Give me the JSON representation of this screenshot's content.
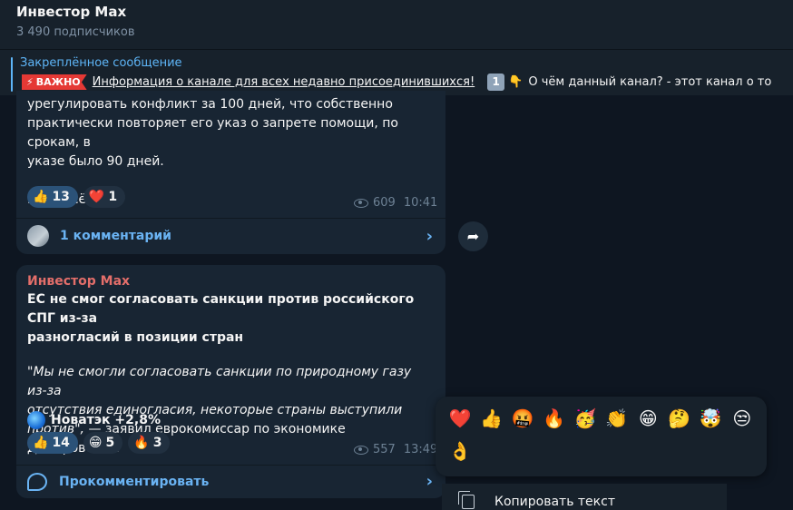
{
  "header": {
    "title": "Инвестор Max",
    "subscribers": "3 490 подписчиков"
  },
  "pinned": {
    "label": "Закреплённое сообщение",
    "badge": "ВАЖНО",
    "link_text": "Информация о канале для всех недавно присоединившихся!",
    "number_emoji": "1",
    "point_emoji": "👇",
    "rest": "О чём данный канал? - этот канал о то"
  },
  "post1": {
    "line1": "урегулировать конфликт за 100 дней, что собственно",
    "line2": "практически повторяет его указ о запрете помощи, по срокам, в",
    "line3": "указе было 90 дней.",
    "line4": "Пока всё.",
    "reactions": [
      {
        "emoji": "👍",
        "count": "13"
      },
      {
        "emoji": "❤️",
        "count": "1"
      }
    ],
    "views": "609",
    "time": "10:41",
    "comments": "1 комментарий"
  },
  "post2": {
    "author": "Инвестор Max",
    "headline1": "ЕС не смог согласовать санкции против российского СПГ из-за",
    "headline2": "разногласий в позиции стран",
    "quote1": "\"Мы не смогли согласовать санкции по природному газу из-за",
    "quote2": "отсутствия единогласия, некоторые страны выступили",
    "quote3": "против\",",
    "quote_tail": " — заявил еврокомиссар по экономике Домбровскис.",
    "stock": "Новатэк +2,8%",
    "reactions": [
      {
        "emoji": "👍",
        "count": "14"
      },
      {
        "emoji": "😁",
        "count": "5"
      },
      {
        "emoji": "🔥",
        "count": "3"
      }
    ],
    "views": "557",
    "time": "13:49",
    "comment_action": "Прокомментировать"
  },
  "reaction_picker": {
    "emojis": [
      "❤️",
      "👍",
      "🤬",
      "🔥",
      "🥳",
      "👏",
      "😁",
      "🤔",
      "🤯",
      "😒",
      "👌"
    ]
  },
  "context_menu": {
    "copy_text": "Копировать текст"
  }
}
